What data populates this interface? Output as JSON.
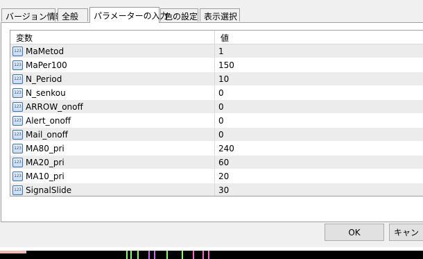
{
  "tabs": [
    {
      "label": "バージョン情報"
    },
    {
      "label": "全般"
    },
    {
      "label": "パラメーターの入力"
    },
    {
      "label": "色の設定"
    },
    {
      "label": "表示選択"
    }
  ],
  "active_tab": "パラメーターの入力",
  "grid": {
    "header_name": "変数",
    "header_value": "値",
    "rows": [
      {
        "name": "MaMetod",
        "value": "1"
      },
      {
        "name": "MaPer100",
        "value": "150"
      },
      {
        "name": "N_Period",
        "value": "10"
      },
      {
        "name": "N_senkou",
        "value": "0"
      },
      {
        "name": "ARROW_onoff",
        "value": "0"
      },
      {
        "name": "Alert_onoff",
        "value": "0"
      },
      {
        "name": "Mail_onoff",
        "value": "0"
      },
      {
        "name": "MA80_pri",
        "value": "240"
      },
      {
        "name": "MA20_pri",
        "value": "60"
      },
      {
        "name": "MA10_pri",
        "value": "20"
      },
      {
        "name": "SignalSlide",
        "value": "30"
      }
    ],
    "row_icon": {
      "name": "integer-param-icon",
      "text": "123"
    }
  },
  "buttons": {
    "ok": "OK",
    "cancel": "キャン"
  },
  "colors": {
    "grid_row_alt": "#ececec",
    "icon_border": "#3a6fb0"
  }
}
